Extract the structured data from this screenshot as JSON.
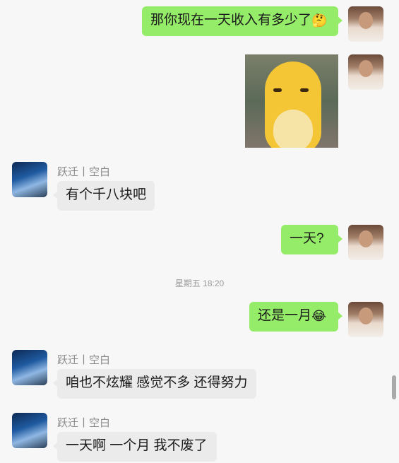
{
  "messages": {
    "m1": {
      "text": "那你现在一天收入有多少了",
      "emoji": "🤔"
    },
    "m3": {
      "sender": "跃迁丨空白",
      "text": "有个千八块吧"
    },
    "m4": {
      "text": "一天?"
    },
    "time_divider": "星期五 18:20",
    "m5": {
      "text": "还是一月",
      "emoji": "😂"
    },
    "m6": {
      "sender": "跃迁丨空白",
      "text": "咱也不炫耀 感觉不多 还得努力"
    },
    "m7": {
      "sender": "跃迁丨空白",
      "text": "一天啊 一个月 我不废了"
    }
  },
  "icons": {
    "self_avatar": "user-avatar-photo",
    "peer_avatar": "mountain-landscape-avatar",
    "sticker": "yellow-cartoon-sticker"
  },
  "colors": {
    "outgoing_bubble": "#95ec69",
    "incoming_bubble": "#ebebeb",
    "background": "#f7f7f7"
  }
}
